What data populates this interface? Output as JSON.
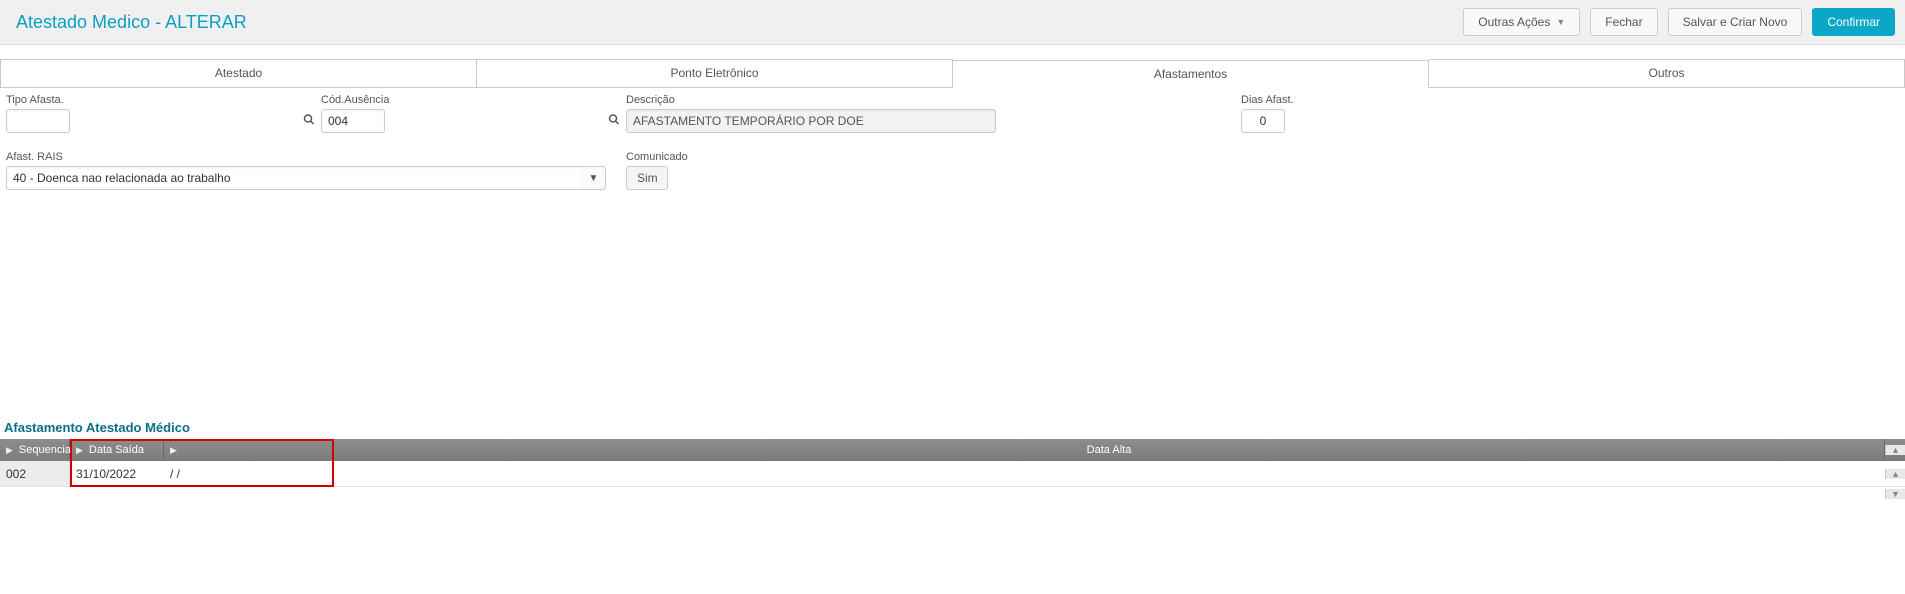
{
  "header": {
    "title": "Atestado Medico - ALTERAR",
    "actions": {
      "other": "Outras Ações",
      "close": "Fechar",
      "save_new": "Salvar e Criar Novo",
      "confirm": "Confirmar"
    }
  },
  "tabs": {
    "atestado": "Atestado",
    "ponto": "Ponto Eletrônico",
    "afastamentos": "Afastamentos",
    "outros": "Outros"
  },
  "form": {
    "tipo_afasta": {
      "label": "Tipo Afasta.",
      "value": ""
    },
    "cod_ausencia": {
      "label": "Cód.Ausência",
      "value": "004"
    },
    "descricao": {
      "label": "Descrição",
      "value": "AFASTAMENTO TEMPORÁRIO POR DOE"
    },
    "dias_afast": {
      "label": "Dias Afast.",
      "value": "0"
    },
    "afast_rais": {
      "label": "Afast. RAIS",
      "value": "40 - Doenca nao relacionada ao trabalho"
    },
    "comunicado": {
      "label": "Comunicado",
      "value": "Sim"
    }
  },
  "grid": {
    "section_title": "Afastamento Atestado Médico",
    "columns": {
      "sequencia": "Sequencia",
      "data_saida": "Data Saída",
      "data_alta": "Data Alta"
    },
    "row": {
      "sequencia": "002",
      "data_saida": "31/10/2022",
      "data_alta": "/  /"
    }
  }
}
